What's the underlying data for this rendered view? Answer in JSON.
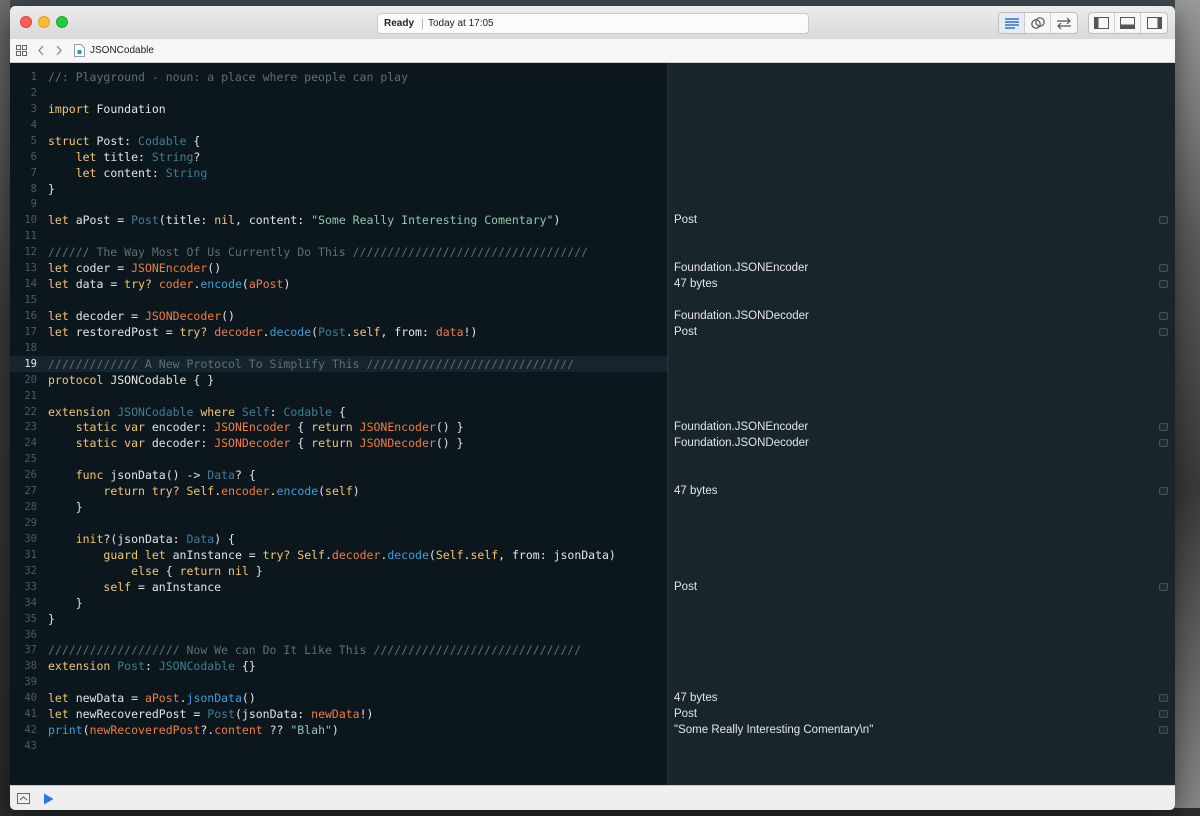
{
  "window": {
    "activity_status": "Ready",
    "activity_time": "Today at 17:05",
    "file_name": "JSONCodable"
  },
  "code_lines": [
    {
      "n": "1",
      "t": [
        {
          "c": "com",
          "s": "//: Playground - noun: a place where people can play"
        }
      ]
    },
    {
      "n": "2",
      "t": []
    },
    {
      "n": "3",
      "t": [
        {
          "c": "kw",
          "s": "import"
        },
        {
          "c": "plain",
          "s": " Foundation"
        }
      ]
    },
    {
      "n": "4",
      "t": []
    },
    {
      "n": "5",
      "t": [
        {
          "c": "kw",
          "s": "struct"
        },
        {
          "c": "plain",
          "s": " Post: "
        },
        {
          "c": "type",
          "s": "Codable"
        },
        {
          "c": "plain",
          "s": " {"
        }
      ]
    },
    {
      "n": "6",
      "t": [
        {
          "c": "plain",
          "s": "    "
        },
        {
          "c": "kw",
          "s": "let"
        },
        {
          "c": "plain",
          "s": " title: "
        },
        {
          "c": "type",
          "s": "String"
        },
        {
          "c": "plain",
          "s": "?"
        }
      ]
    },
    {
      "n": "7",
      "t": [
        {
          "c": "plain",
          "s": "    "
        },
        {
          "c": "kw",
          "s": "let"
        },
        {
          "c": "plain",
          "s": " content: "
        },
        {
          "c": "type",
          "s": "String"
        }
      ]
    },
    {
      "n": "8",
      "t": [
        {
          "c": "plain",
          "s": "}"
        }
      ]
    },
    {
      "n": "9",
      "t": []
    },
    {
      "n": "10",
      "t": [
        {
          "c": "kw",
          "s": "let"
        },
        {
          "c": "plain",
          "s": " aPost = "
        },
        {
          "c": "type",
          "s": "Post"
        },
        {
          "c": "plain",
          "s": "(title: "
        },
        {
          "c": "kw",
          "s": "nil"
        },
        {
          "c": "plain",
          "s": ", content: "
        },
        {
          "c": "str",
          "s": "\"Some Really Interesting Comentary\""
        },
        {
          "c": "plain",
          "s": ")"
        }
      ]
    },
    {
      "n": "11",
      "t": []
    },
    {
      "n": "12",
      "t": [
        {
          "c": "com",
          "s": "////// The Way Most Of Us Currently Do This //////////////////////////////////"
        }
      ]
    },
    {
      "n": "13",
      "t": [
        {
          "c": "kw",
          "s": "let"
        },
        {
          "c": "plain",
          "s": " coder = "
        },
        {
          "c": "call",
          "s": "JSONEncoder"
        },
        {
          "c": "plain",
          "s": "()"
        }
      ]
    },
    {
      "n": "14",
      "t": [
        {
          "c": "kw",
          "s": "let"
        },
        {
          "c": "plain",
          "s": " data = "
        },
        {
          "c": "kw",
          "s": "try?"
        },
        {
          "c": "plain",
          "s": " "
        },
        {
          "c": "call",
          "s": "coder"
        },
        {
          "c": "plain",
          "s": "."
        },
        {
          "c": "meth",
          "s": "encode"
        },
        {
          "c": "plain",
          "s": "("
        },
        {
          "c": "call",
          "s": "aPost"
        },
        {
          "c": "plain",
          "s": ")"
        }
      ]
    },
    {
      "n": "15",
      "t": []
    },
    {
      "n": "16",
      "t": [
        {
          "c": "kw",
          "s": "let"
        },
        {
          "c": "plain",
          "s": " decoder = "
        },
        {
          "c": "call",
          "s": "JSONDecoder"
        },
        {
          "c": "plain",
          "s": "()"
        }
      ]
    },
    {
      "n": "17",
      "t": [
        {
          "c": "kw",
          "s": "let"
        },
        {
          "c": "plain",
          "s": " restoredPost = "
        },
        {
          "c": "kw",
          "s": "try?"
        },
        {
          "c": "plain",
          "s": " "
        },
        {
          "c": "call",
          "s": "decoder"
        },
        {
          "c": "plain",
          "s": "."
        },
        {
          "c": "meth",
          "s": "decode"
        },
        {
          "c": "plain",
          "s": "("
        },
        {
          "c": "type",
          "s": "Post"
        },
        {
          "c": "plain",
          "s": "."
        },
        {
          "c": "kw",
          "s": "self"
        },
        {
          "c": "plain",
          "s": ", from: "
        },
        {
          "c": "call",
          "s": "data"
        },
        {
          "c": "plain",
          "s": "!)"
        }
      ]
    },
    {
      "n": "18",
      "t": []
    },
    {
      "n": "19",
      "current": true,
      "t": [
        {
          "c": "com",
          "s": "///////////// A New Protocol To Simplify This //////////////////////////////"
        }
      ]
    },
    {
      "n": "20",
      "t": [
        {
          "c": "kw",
          "s": "protocol"
        },
        {
          "c": "plain",
          "s": " JSONCodable { }"
        }
      ]
    },
    {
      "n": "21",
      "t": []
    },
    {
      "n": "22",
      "t": [
        {
          "c": "kw",
          "s": "extension"
        },
        {
          "c": "plain",
          "s": " "
        },
        {
          "c": "type",
          "s": "JSONCodable"
        },
        {
          "c": "plain",
          "s": " "
        },
        {
          "c": "kw",
          "s": "where"
        },
        {
          "c": "plain",
          "s": " "
        },
        {
          "c": "type",
          "s": "Self"
        },
        {
          "c": "plain",
          "s": ": "
        },
        {
          "c": "type",
          "s": "Codable"
        },
        {
          "c": "plain",
          "s": " {"
        }
      ]
    },
    {
      "n": "23",
      "t": [
        {
          "c": "plain",
          "s": "    "
        },
        {
          "c": "kw",
          "s": "static var"
        },
        {
          "c": "plain",
          "s": " encoder: "
        },
        {
          "c": "call",
          "s": "JSONEncoder"
        },
        {
          "c": "plain",
          "s": " { "
        },
        {
          "c": "kw",
          "s": "return"
        },
        {
          "c": "plain",
          "s": " "
        },
        {
          "c": "call",
          "s": "JSONEncoder"
        },
        {
          "c": "plain",
          "s": "() }"
        }
      ]
    },
    {
      "n": "24",
      "t": [
        {
          "c": "plain",
          "s": "    "
        },
        {
          "c": "kw",
          "s": "static var"
        },
        {
          "c": "plain",
          "s": " decoder: "
        },
        {
          "c": "call",
          "s": "JSONDecoder"
        },
        {
          "c": "plain",
          "s": " { "
        },
        {
          "c": "kw",
          "s": "return"
        },
        {
          "c": "plain",
          "s": " "
        },
        {
          "c": "call",
          "s": "JSONDecoder"
        },
        {
          "c": "plain",
          "s": "() }"
        }
      ]
    },
    {
      "n": "25",
      "t": []
    },
    {
      "n": "26",
      "t": [
        {
          "c": "plain",
          "s": "    "
        },
        {
          "c": "kw",
          "s": "func"
        },
        {
          "c": "plain",
          "s": " jsonData() -> "
        },
        {
          "c": "type",
          "s": "Data"
        },
        {
          "c": "plain",
          "s": "? {"
        }
      ]
    },
    {
      "n": "27",
      "t": [
        {
          "c": "plain",
          "s": "        "
        },
        {
          "c": "kw",
          "s": "return try?"
        },
        {
          "c": "plain",
          "s": " "
        },
        {
          "c": "kw",
          "s": "Self"
        },
        {
          "c": "plain",
          "s": "."
        },
        {
          "c": "call",
          "s": "encoder"
        },
        {
          "c": "plain",
          "s": "."
        },
        {
          "c": "meth",
          "s": "encode"
        },
        {
          "c": "plain",
          "s": "("
        },
        {
          "c": "kw",
          "s": "self"
        },
        {
          "c": "plain",
          "s": ")"
        }
      ]
    },
    {
      "n": "28",
      "t": [
        {
          "c": "plain",
          "s": "    }"
        }
      ]
    },
    {
      "n": "29",
      "t": []
    },
    {
      "n": "30",
      "t": [
        {
          "c": "plain",
          "s": "    "
        },
        {
          "c": "kw",
          "s": "init"
        },
        {
          "c": "plain",
          "s": "?(jsonData: "
        },
        {
          "c": "type",
          "s": "Data"
        },
        {
          "c": "plain",
          "s": ") {"
        }
      ]
    },
    {
      "n": "31",
      "t": [
        {
          "c": "plain",
          "s": "        "
        },
        {
          "c": "kw",
          "s": "guard let"
        },
        {
          "c": "plain",
          "s": " anInstance = "
        },
        {
          "c": "kw",
          "s": "try?"
        },
        {
          "c": "plain",
          "s": " "
        },
        {
          "c": "kw",
          "s": "Self"
        },
        {
          "c": "plain",
          "s": "."
        },
        {
          "c": "call",
          "s": "decoder"
        },
        {
          "c": "plain",
          "s": "."
        },
        {
          "c": "meth",
          "s": "decode"
        },
        {
          "c": "plain",
          "s": "("
        },
        {
          "c": "kw",
          "s": "Self"
        },
        {
          "c": "plain",
          "s": "."
        },
        {
          "c": "kw",
          "s": "self"
        },
        {
          "c": "plain",
          "s": ", from: jsonData)"
        }
      ]
    },
    {
      "n": "32",
      "t": [
        {
          "c": "plain",
          "s": "            "
        },
        {
          "c": "kw",
          "s": "else"
        },
        {
          "c": "plain",
          "s": " { "
        },
        {
          "c": "kw",
          "s": "return nil"
        },
        {
          "c": "plain",
          "s": " }"
        }
      ]
    },
    {
      "n": "33",
      "t": [
        {
          "c": "plain",
          "s": "        "
        },
        {
          "c": "kw",
          "s": "self"
        },
        {
          "c": "plain",
          "s": " = anInstance"
        }
      ]
    },
    {
      "n": "34",
      "t": [
        {
          "c": "plain",
          "s": "    }"
        }
      ]
    },
    {
      "n": "35",
      "t": [
        {
          "c": "plain",
          "s": "}"
        }
      ]
    },
    {
      "n": "36",
      "t": []
    },
    {
      "n": "37",
      "t": [
        {
          "c": "com",
          "s": "/////////////////// Now We can Do It Like This //////////////////////////////"
        }
      ]
    },
    {
      "n": "38",
      "t": [
        {
          "c": "kw",
          "s": "extension"
        },
        {
          "c": "plain",
          "s": " "
        },
        {
          "c": "type",
          "s": "Post"
        },
        {
          "c": "plain",
          "s": ": "
        },
        {
          "c": "type",
          "s": "JSONCodable"
        },
        {
          "c": "plain",
          "s": " {}"
        }
      ]
    },
    {
      "n": "39",
      "t": []
    },
    {
      "n": "40",
      "t": [
        {
          "c": "kw",
          "s": "let"
        },
        {
          "c": "plain",
          "s": " newData = "
        },
        {
          "c": "call",
          "s": "aPost"
        },
        {
          "c": "plain",
          "s": "."
        },
        {
          "c": "meth",
          "s": "jsonData"
        },
        {
          "c": "plain",
          "s": "()"
        }
      ]
    },
    {
      "n": "41",
      "t": [
        {
          "c": "kw",
          "s": "let"
        },
        {
          "c": "plain",
          "s": " newRecoveredPost = "
        },
        {
          "c": "type",
          "s": "Post"
        },
        {
          "c": "plain",
          "s": "(jsonData: "
        },
        {
          "c": "call",
          "s": "newData"
        },
        {
          "c": "plain",
          "s": "!)"
        }
      ]
    },
    {
      "n": "42",
      "t": [
        {
          "c": "meth",
          "s": "print"
        },
        {
          "c": "plain",
          "s": "("
        },
        {
          "c": "call",
          "s": "newRecoveredPost"
        },
        {
          "c": "plain",
          "s": "?."
        },
        {
          "c": "call",
          "s": "content"
        },
        {
          "c": "plain",
          "s": " ?? "
        },
        {
          "c": "str",
          "s": "\"Blah\""
        },
        {
          "c": "plain",
          "s": ")"
        }
      ]
    },
    {
      "n": "43",
      "t": []
    }
  ],
  "results": [
    {
      "line": 10,
      "text": "Post"
    },
    {
      "line": 13,
      "text": "Foundation.JSONEncoder"
    },
    {
      "line": 14,
      "text": "47 bytes"
    },
    {
      "line": 16,
      "text": "Foundation.JSONDecoder"
    },
    {
      "line": 17,
      "text": "Post"
    },
    {
      "line": 23,
      "text": "Foundation.JSONEncoder"
    },
    {
      "line": 24,
      "text": "Foundation.JSONDecoder"
    },
    {
      "line": 27,
      "text": "47 bytes"
    },
    {
      "line": 33,
      "text": "Post"
    },
    {
      "line": 40,
      "text": "47 bytes"
    },
    {
      "line": 41,
      "text": "Post"
    },
    {
      "line": 42,
      "text": "\"Some Really Interesting Comentary\\n\""
    }
  ]
}
